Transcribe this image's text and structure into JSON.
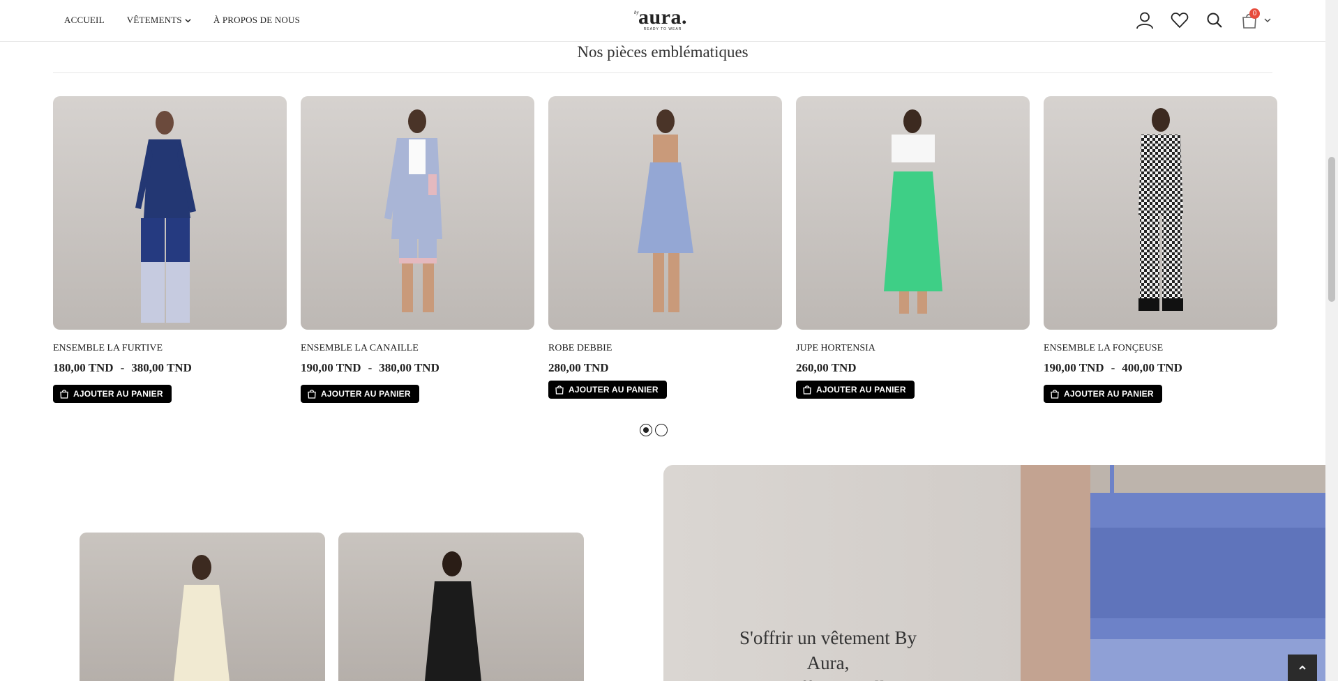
{
  "header": {
    "nav": [
      {
        "label": "ACCUEIL",
        "has_dropdown": false
      },
      {
        "label": "VÊTEMENTS",
        "has_dropdown": true
      },
      {
        "label": "À PROPOS DE NOUS",
        "has_dropdown": false
      }
    ],
    "logo": {
      "by": "by",
      "name": "aura.",
      "tagline": "READY TO WEAR"
    },
    "icons": [
      "user-icon",
      "heart-icon",
      "search-icon",
      "cart-icon"
    ],
    "cart_count": "0"
  },
  "section": {
    "title": "Nos pièces emblématiques"
  },
  "products": [
    {
      "name": "ENSEMBLE LA FURTIVE",
      "price_from": "180,00 TND",
      "price_sep": "-",
      "price_to": "380,00 TND",
      "button": "AJOUTER AU PANIER"
    },
    {
      "name": "ENSEMBLE LA CANAILLE",
      "price_from": "190,00 TND",
      "price_sep": "-",
      "price_to": "380,00 TND",
      "button": "AJOUTER AU PANIER"
    },
    {
      "name": "ROBE DEBBIE",
      "price_from": "280,00 TND",
      "price_sep": "",
      "price_to": "",
      "button": "AJOUTER AU PANIER"
    },
    {
      "name": "JUPE HORTENSIA",
      "price_from": "260,00 TND",
      "price_sep": "",
      "price_to": "",
      "button": "AJOUTER AU PANIER"
    },
    {
      "name": "ENSEMBLE LA FONÇEUSE",
      "price_from": "190,00 TND",
      "price_sep": "-",
      "price_to": "400,00 TND",
      "button": "AJOUTER AU PANIER"
    }
  ],
  "carousel": {
    "pages": 2,
    "active": 1
  },
  "banner": {
    "line1": "S'offrir un vêtement By Aura,",
    "line2": "c'est s'offrir une allure,"
  },
  "colors": {
    "accent": "#000000",
    "badge": "#e74c3c",
    "background": "#ffffff"
  }
}
